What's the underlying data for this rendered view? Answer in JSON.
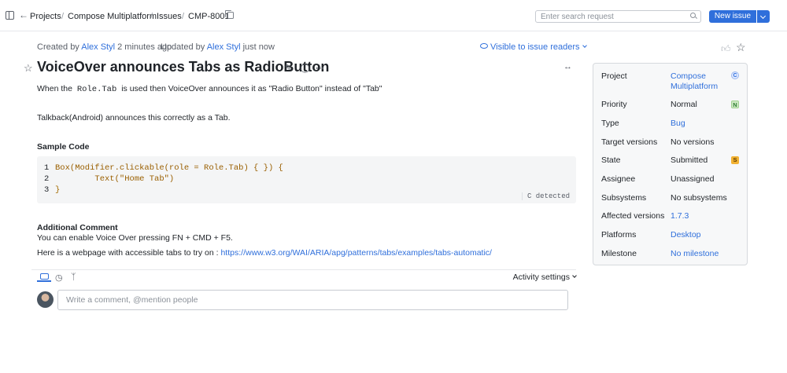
{
  "breadcrumb": {
    "projects": "Projects",
    "project": "Compose Multiplatform",
    "issues": "Issues",
    "issue_id": "CMP-8001"
  },
  "header": {
    "search_placeholder": "Enter search request",
    "new_issue": "New issue"
  },
  "meta": {
    "created_by_prefix": "Created by",
    "creator": "Alex Styl",
    "created_time": "2 minutes ago",
    "updated_by_prefix": "Updated by",
    "updater": "Alex Styl",
    "updated_time": "just now",
    "visibility": "Visible to issue readers"
  },
  "issue": {
    "title": "VoiceOver announces Tabs as RadioButton",
    "desc_before": "When the",
    "desc_code": "Role.Tab",
    "desc_after": "is used then VoiceOver announces it as \"Radio Button\" instead of \"Tab\"",
    "talkback": "Talkback(Android) announces this correctly as a Tab.",
    "sample_heading": "Sample Code",
    "code_lines": [
      {
        "n": "1",
        "text": "Box(Modifier.clickable(role = Role.Tab) { }) {"
      },
      {
        "n": "2",
        "text": "        Text(\"Home Tab\")"
      },
      {
        "n": "3",
        "text": "}"
      }
    ],
    "code_detected": "C detected",
    "additional_heading": "Additional Comment",
    "additional_text": "You can enable Voice Over pressing FN + CMD + F5.",
    "webpage_prefix": "Here is a webpage with accessible tabs to try on :",
    "webpage_link": "https://www.w3.org/WAI/ARIA/apg/patterns/tabs/examples/tabs-automatic/"
  },
  "activity": {
    "settings": "Activity settings",
    "comment_placeholder": "Write a comment, @mention people"
  },
  "fields": [
    {
      "label": "Project",
      "value": "Compose Multiplatform",
      "link": true,
      "badge": "C"
    },
    {
      "label": "Priority",
      "value": "Normal",
      "link": false,
      "badge": "N"
    },
    {
      "label": "Type",
      "value": "Bug",
      "link": true,
      "badge": ""
    },
    {
      "label": "Target versions",
      "value": "No versions",
      "link": false,
      "badge": ""
    },
    {
      "label": "State",
      "value": "Submitted",
      "link": false,
      "badge": "S"
    },
    {
      "label": "Assignee",
      "value": "Unassigned",
      "link": false,
      "badge": ""
    },
    {
      "label": "Subsystems",
      "value": "No subsystems",
      "link": false,
      "badge": ""
    },
    {
      "label": "Affected versions",
      "value": "1.7.3",
      "link": true,
      "badge": ""
    },
    {
      "label": "Platforms",
      "value": "Desktop",
      "link": true,
      "badge": ""
    },
    {
      "label": "Milestone",
      "value": "No milestone",
      "link": true,
      "badge": ""
    }
  ],
  "colors": {
    "accent": "#2f6fdb",
    "badge_normal": "#cde9c4",
    "badge_submitted": "#f2b233"
  }
}
